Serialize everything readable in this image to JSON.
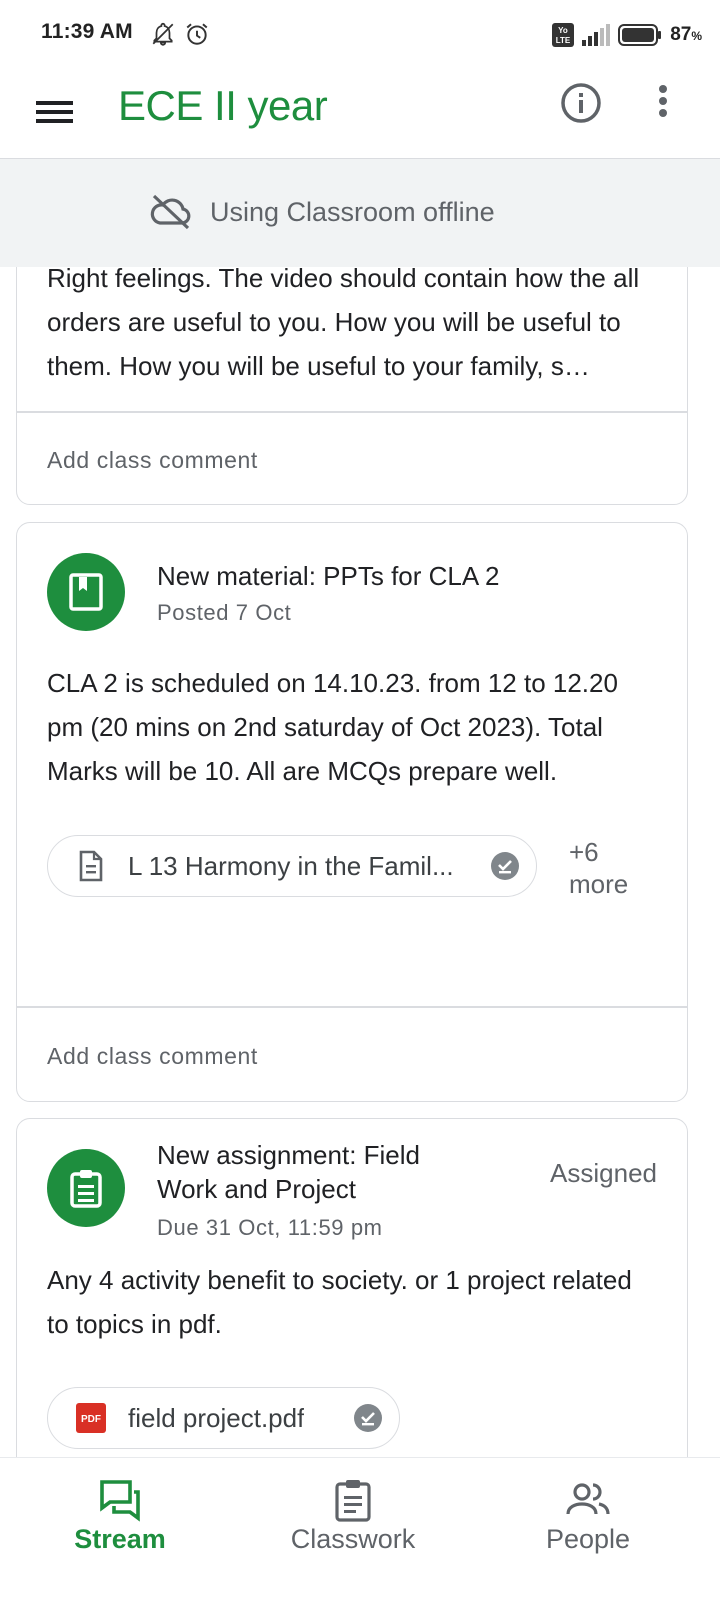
{
  "status_bar": {
    "time": "11:39 AM",
    "battery_percent": "87",
    "battery_unit": "%",
    "network_badge": "LTE",
    "network_badge_top": "Yo"
  },
  "app_bar": {
    "title": "ECE II year",
    "menu_icon": "hamburger-menu-icon",
    "info_icon": "info-icon",
    "more_icon": "more-vert-icon"
  },
  "offline_banner": {
    "text": "Using Classroom offline",
    "icon": "cloud-off-icon"
  },
  "posts": [
    {
      "body": "Right feelings. The video should contain how the all orders are useful to you. How you will be useful to them. How you will be useful to your family, s…",
      "comment_placeholder": "Add class comment"
    },
    {
      "type_icon": "material-book-icon",
      "title": "New material: PPTs for CLA 2",
      "subtitle": "Posted 7 Oct",
      "body": "CLA 2 is scheduled on 14.10.23. from 12 to 12.20 pm (20 mins on 2nd saturday of Oct 2023). Total Marks will be 10. All are MCQs prepare well.",
      "attachment": {
        "name": "L 13 Harmony in the Famil...",
        "icon": "document-icon",
        "status_icon": "offline-available-icon"
      },
      "more_attachments_line1": "+6",
      "more_attachments_line2": "more",
      "comment_placeholder": "Add class comment"
    },
    {
      "type_icon": "assignment-clipboard-icon",
      "title_line1": "New assignment: Field",
      "title_line2": "Work and Project",
      "subtitle": "Due 31 Oct, 11:59 pm",
      "status": "Assigned",
      "body": "Any 4 activity benefit to society. or 1 project related to topics in pdf.",
      "attachment": {
        "name": "field project.pdf",
        "icon": "pdf-icon",
        "icon_text": "PDF",
        "status_icon": "offline-available-icon"
      }
    }
  ],
  "bottom_nav": {
    "items": [
      {
        "label": "Stream",
        "icon": "stream-icon",
        "active": true
      },
      {
        "label": "Classwork",
        "icon": "classwork-icon",
        "active": false
      },
      {
        "label": "People",
        "icon": "people-icon",
        "active": false
      }
    ]
  },
  "colors": {
    "brand_green": "#1e8e3e",
    "text_secondary": "#5f6368",
    "divider": "#dadce0",
    "banner_bg": "#f1f3f4",
    "pdf_red": "#d93025"
  }
}
